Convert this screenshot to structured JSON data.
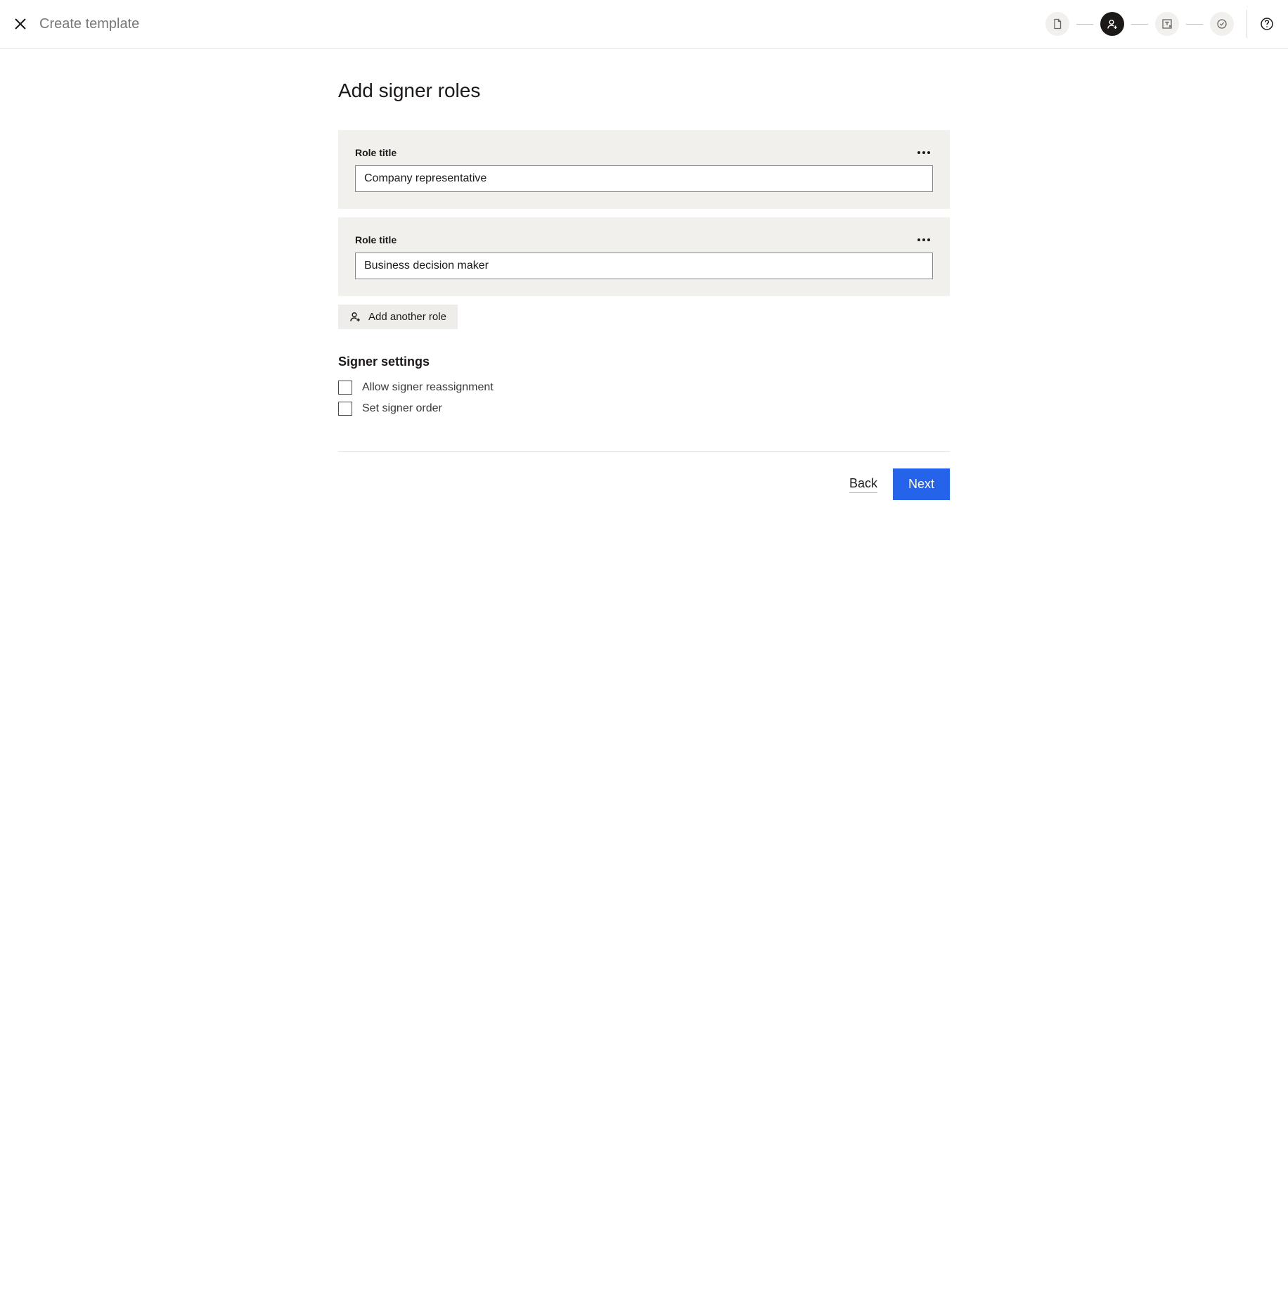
{
  "header": {
    "title": "Create template"
  },
  "page": {
    "heading": "Add signer roles"
  },
  "roles": [
    {
      "label": "Role title",
      "value": "Company representative"
    },
    {
      "label": "Role title",
      "value": "Business decision maker"
    }
  ],
  "actions": {
    "add_role": "Add another role",
    "back": "Back",
    "next": "Next"
  },
  "settings": {
    "heading": "Signer settings",
    "allow_reassignment": "Allow signer reassignment",
    "set_order": "Set signer order"
  }
}
